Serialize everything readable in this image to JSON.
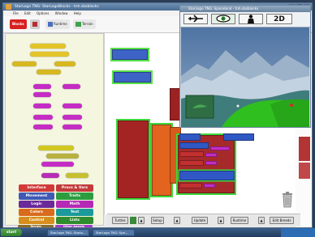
{
  "window": {
    "title": "StarLogo TNG: StarLogoBlocks - tnh.sbsblocks"
  },
  "menubar": [
    "File",
    "Edit",
    "Options",
    "Window",
    "Help"
  ],
  "toolbar": {
    "tabs": [
      {
        "label": "Blocks"
      },
      {
        "label": "Runtime"
      },
      {
        "label": "Terrain"
      }
    ]
  },
  "palette": {
    "categories": [
      {
        "label": "Interface",
        "color": "#d23a3a"
      },
      {
        "label": "Procs & Vars",
        "color": "#c33a3a"
      },
      {
        "label": "Movement",
        "color": "#3f59b5"
      },
      {
        "label": "Traits",
        "color": "#2c9c3e"
      },
      {
        "label": "Logic",
        "color": "#6a2a9a"
      },
      {
        "label": "Math",
        "color": "#b52ab5"
      },
      {
        "label": "Colors",
        "color": "#d96b1d"
      },
      {
        "label": "Text",
        "color": "#1a9a9a"
      },
      {
        "label": "Control",
        "color": "#d68f1e"
      },
      {
        "label": "Lists",
        "color": "#2f8c2f"
      },
      {
        "label": "Terrain",
        "color": "#8a6b2a"
      },
      {
        "label": "Other Agents",
        "color": "#a03ac7"
      }
    ]
  },
  "viewer": {
    "title": "StarLogo TNG: Spaceland - tnh.sbsblocks",
    "mode_label": "2D"
  },
  "bottombar": {
    "items": [
      {
        "label": "Turtles"
      },
      {
        "label": "Setup"
      },
      {
        "label": "Update"
      },
      {
        "label": "Runtime"
      },
      {
        "label": "Edit Breeds"
      }
    ]
  },
  "taskbar": {
    "start_label": "start",
    "items": [
      "StarLogo TNG: Starlo...",
      "StarLogo TNG: Spa..."
    ]
  }
}
